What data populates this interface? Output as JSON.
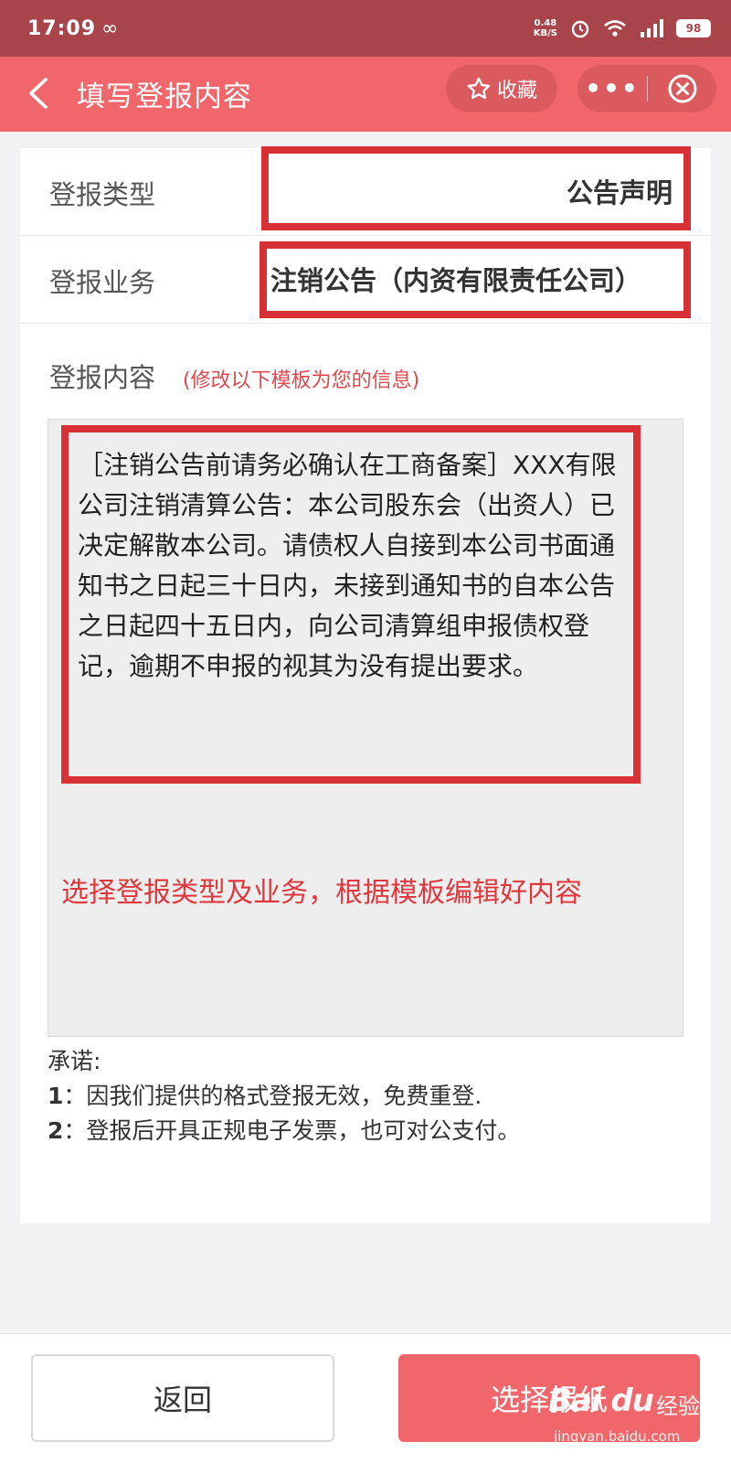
{
  "status_bar": {
    "time": "17:09",
    "net_speed_value": "0.48",
    "net_speed_unit": "KB/S",
    "battery": "98"
  },
  "header": {
    "title": "填写登报内容",
    "favorite_label": "收藏",
    "more_label": "•••"
  },
  "form": {
    "type_label": "登报类型",
    "type_value": "公告声明",
    "business_label": "登报业务",
    "business_value": "注销公告（内资有限责任公司）",
    "content_label": "登报内容",
    "content_hint": "(修改以下模板为您的信息)",
    "template_text": "［注销公告前请务必确认在工商备案］XXX有限公司注销清算公告：本公司股东会（出资人）已决定解散本公司。请债权人自接到本公司书面通知书之日起三十日内，未接到通知书的自本公告之日起四十五日内，向公司清算组申报债权登记，逾期不申报的视其为没有提出要求。",
    "instruction": "选择登报类型及业务，根据模板编辑好内容"
  },
  "promise": {
    "title": "承诺:",
    "items": [
      {
        "num": "1",
        "text": "：因我们提供的格式登报无效，免费重登."
      },
      {
        "num": "2",
        "text": "：登报后开具正规电子发票，也可对公支付。"
      }
    ]
  },
  "footer": {
    "back_label": "返回",
    "select_label": "选择报纸"
  },
  "watermark": {
    "logo": "Bai du",
    "brand": "经验",
    "url": "jingyan.baidu.com"
  },
  "colors": {
    "status_bar": "#a8454a",
    "header": "#f1666a",
    "highlight_border": "#d93035",
    "instruction_text": "#e0373c"
  }
}
